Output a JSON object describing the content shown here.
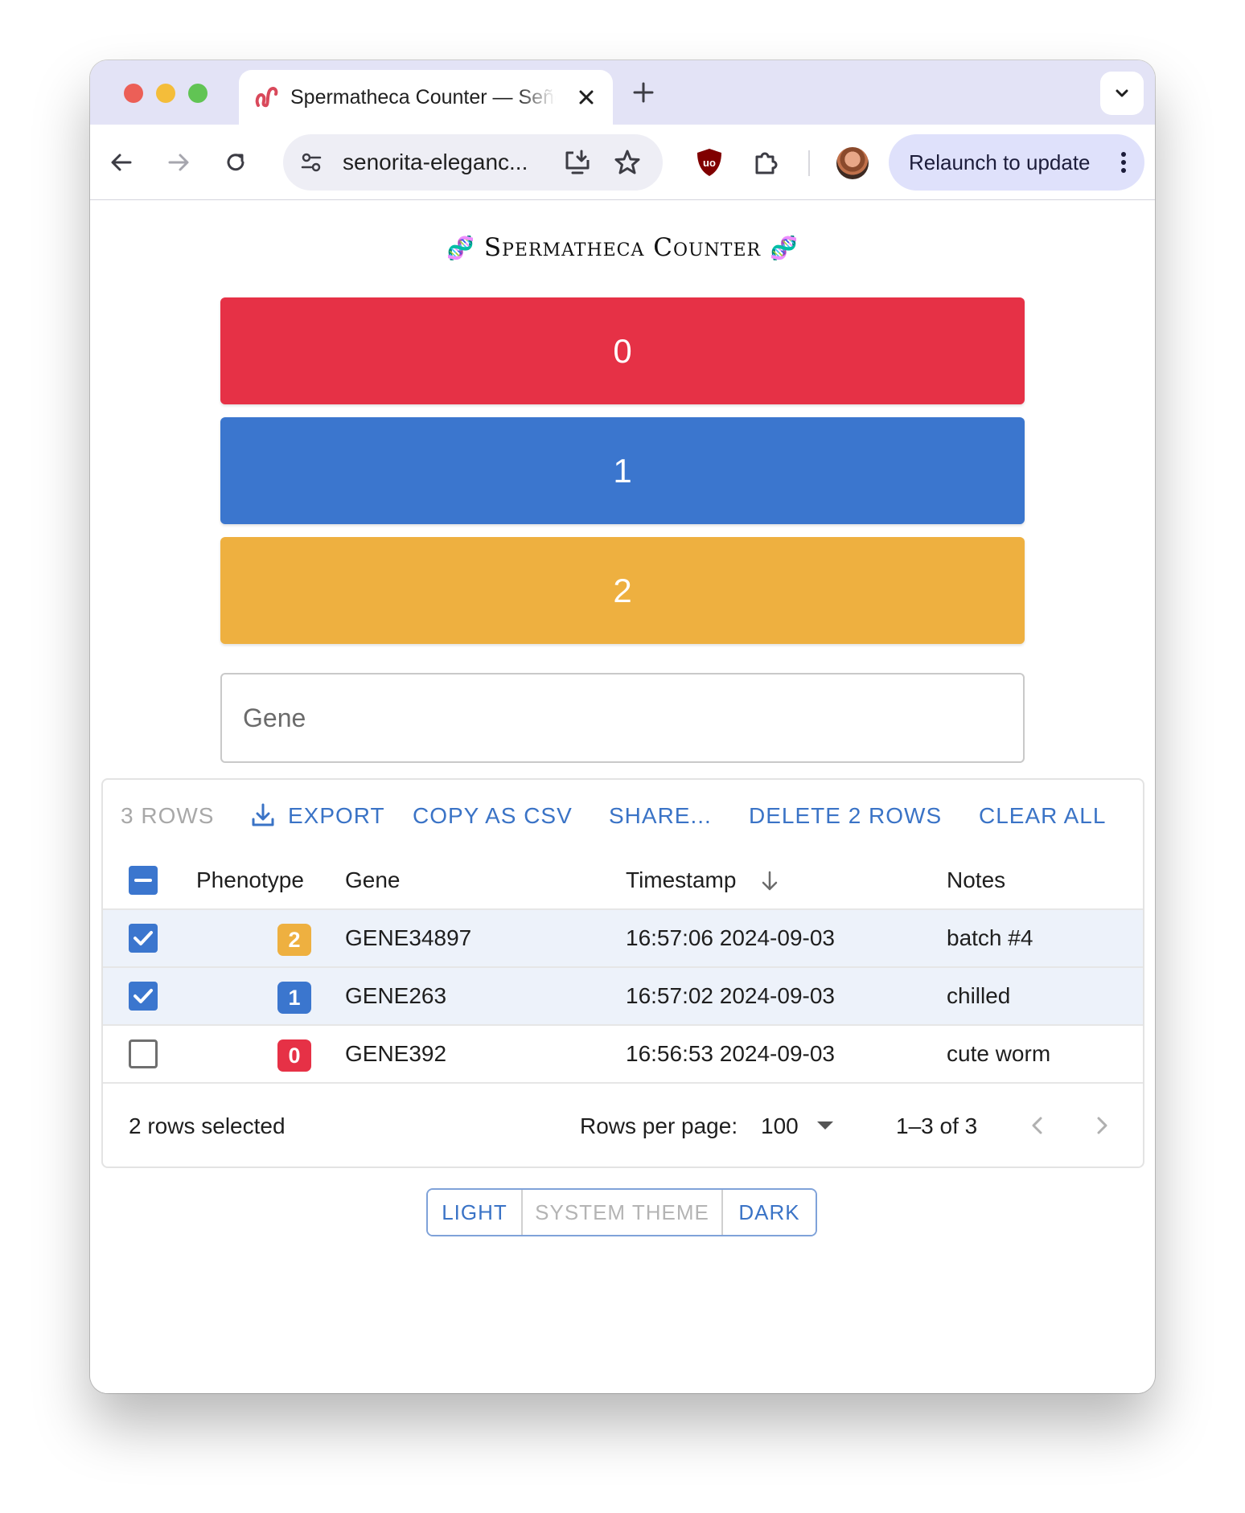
{
  "browser": {
    "tab_title": "Spermatheca Counter — Señorita Elegance",
    "url": "senorita-eleganc...",
    "relaunch_label": "Relaunch to update"
  },
  "app": {
    "title": "Spermatheca Counter",
    "title_icon": "🧬",
    "counter_buttons": [
      {
        "label": "0",
        "color": "#e63146"
      },
      {
        "label": "1",
        "color": "#3b76ce"
      },
      {
        "label": "2",
        "color": "#eeb040"
      }
    ],
    "gene_input": {
      "placeholder": "Gene",
      "value": ""
    }
  },
  "grid": {
    "toolbar": {
      "rows_count": "3 ROWS",
      "export": "EXPORT",
      "copy_csv": "COPY AS CSV",
      "share": "SHARE...",
      "delete": "DELETE 2 ROWS",
      "clear": "CLEAR ALL"
    },
    "columns": {
      "phenotype": "Phenotype",
      "gene": "Gene",
      "timestamp": "Timestamp",
      "notes": "Notes"
    },
    "sort": {
      "column": "timestamp",
      "direction": "descending"
    },
    "rows": [
      {
        "phenotype": "2",
        "phenotype_color": "#eeb040",
        "gene": "GENE34897",
        "timestamp": "16:57:06 2024-09-03",
        "notes": "batch #4",
        "selected": true
      },
      {
        "phenotype": "1",
        "phenotype_color": "#3b76ce",
        "gene": "GENE263",
        "timestamp": "16:57:02 2024-09-03",
        "notes": "chilled",
        "selected": true
      },
      {
        "phenotype": "0",
        "phenotype_color": "#e63146",
        "gene": "GENE392",
        "timestamp": "16:56:53 2024-09-03",
        "notes": "cute worm",
        "selected": false
      }
    ],
    "footer": {
      "selected_text": "2 rows selected",
      "rows_per_page_label": "Rows per page:",
      "rows_per_page_value": "100",
      "range": "1–3 of 3"
    }
  },
  "theme": {
    "light": "LIGHT",
    "system": "SYSTEM THEME",
    "dark": "DARK"
  }
}
